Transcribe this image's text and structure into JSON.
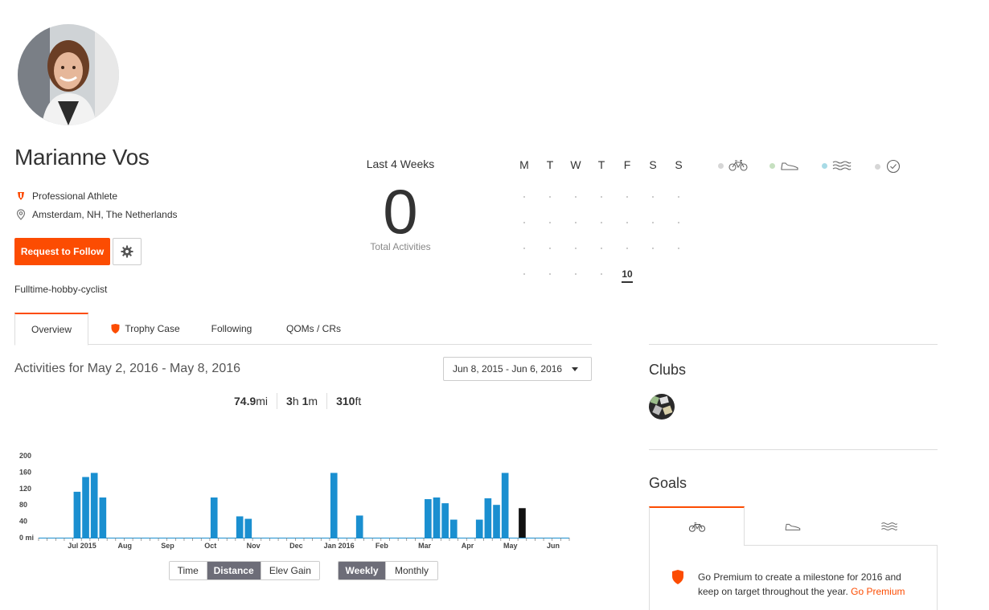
{
  "profile": {
    "name": "Marianne Vos",
    "badge": "Professional Athlete",
    "location": "Amsterdam, NH, The Netherlands",
    "follow_label": "Request to Follow",
    "bio": "Fulltime-hobby-cyclist"
  },
  "last_weeks": {
    "title": "Last 4 Weeks",
    "count": "0",
    "label": "Total Activities"
  },
  "calendar": {
    "days": [
      "M",
      "T",
      "W",
      "T",
      "F",
      "S",
      "S"
    ],
    "today": "10"
  },
  "legend": [
    "bike-icon",
    "run-shoe-icon",
    "swim-icon",
    "other-activity-icon"
  ],
  "legend_colors": [
    "#d6d6d6",
    "#c6e0c0",
    "#a8dbe6",
    "#d6d6d6"
  ],
  "tabs": [
    "Overview",
    "Trophy Case",
    "Following",
    "QOMs / CRs"
  ],
  "activities": {
    "title": "Activities for May 2, 2016 - May 8, 2016",
    "range": "Jun 8, 2015 - Jun 6, 2016",
    "distance_value": "74.9",
    "distance_unit": "mi",
    "time_h": "3",
    "time_h_unit": "h",
    "time_m": "1",
    "time_m_unit": "m",
    "elev_value": "310",
    "elev_unit": "ft"
  },
  "chart_data": {
    "type": "bar",
    "yticks": [
      "200",
      "160",
      "120",
      "80",
      "40",
      "0 mi"
    ],
    "ylim": [
      0,
      200
    ],
    "xticks": [
      "Jul 2015",
      "Aug",
      "Sep",
      "Oct",
      "Nov",
      "Dec",
      "Jan 2016",
      "Feb",
      "Mar",
      "Apr",
      "May",
      "Jun"
    ],
    "values": [
      0,
      0,
      0,
      0,
      112,
      148,
      158,
      98,
      0,
      0,
      0,
      0,
      0,
      0,
      0,
      0,
      0,
      0,
      0,
      0,
      98,
      0,
      0,
      52,
      46,
      0,
      0,
      0,
      0,
      0,
      0,
      0,
      0,
      0,
      158,
      0,
      0,
      54,
      0,
      0,
      0,
      0,
      0,
      0,
      0,
      94,
      98,
      84,
      44,
      0,
      0,
      44,
      96,
      80,
      158,
      0,
      72,
      0,
      0,
      0,
      0,
      0
    ],
    "highlight_index": 56,
    "bar_color": "#1a8fd0",
    "highlight_color": "#111111"
  },
  "chart_toggles": {
    "metrics": [
      "Time",
      "Distance",
      "Elev Gain"
    ],
    "active_metric": "Distance",
    "periods": [
      "Weekly",
      "Monthly"
    ],
    "active_period": "Weekly"
  },
  "sidebar": {
    "clubs_title": "Clubs",
    "goals_title": "Goals",
    "premium_text": "Go Premium to create a milestone for 2016 and keep on target throughout the year.",
    "premium_link": "Go Premium"
  },
  "brand_color": "#fc4c02"
}
